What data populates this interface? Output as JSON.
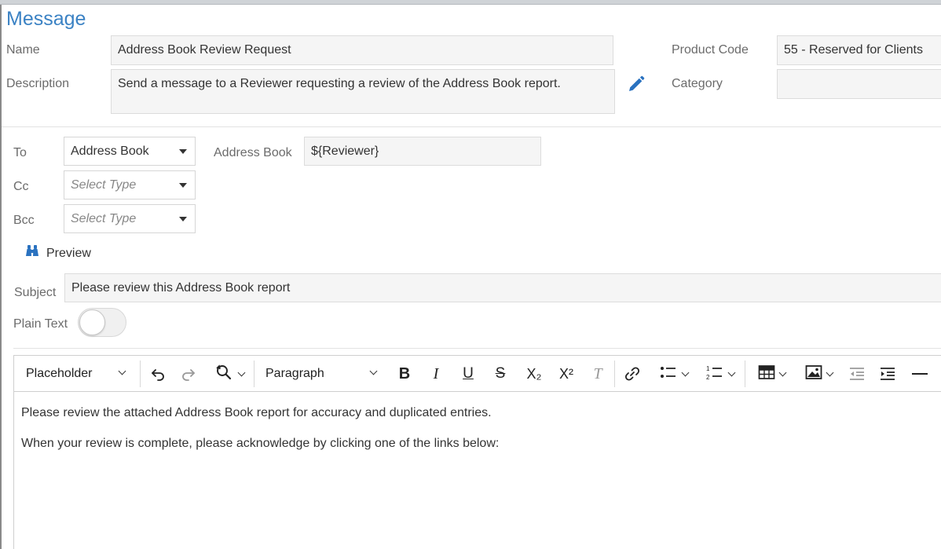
{
  "header": {
    "title": "Message"
  },
  "details": {
    "name_label": "Name",
    "name_value": "Address Book Review Request",
    "description_label": "Description",
    "description_value": "Send a message to a Reviewer requesting a review of the Address Book report.",
    "product_code_label": "Product Code",
    "product_code_value": "55 - Reserved for Clients",
    "category_label": "Category",
    "category_value": ""
  },
  "recipients": {
    "to_label": "To",
    "to_value": "Address Book",
    "address_book_label": "Address Book",
    "address_book_value": "${Reviewer}",
    "cc_label": "Cc",
    "cc_placeholder": "Select Type",
    "bcc_label": "Bcc",
    "bcc_placeholder": "Select Type"
  },
  "preview": {
    "label": "Preview"
  },
  "subject": {
    "label": "Subject",
    "value": "Please review this Address Book report"
  },
  "plain_text": {
    "label": "Plain Text",
    "enabled": false
  },
  "toolbar": {
    "placeholder_label": "Placeholder",
    "paragraph_label": "Paragraph",
    "subscript_glyph": "X₂",
    "superscript_glyph": "X²",
    "clear_format_glyph": "T"
  },
  "editor": {
    "paragraphs": [
      "Please review the attached Address Book report for accuracy and duplicated entries.",
      "When your review is complete, please acknowledge by clicking one of the links below:"
    ]
  },
  "colors": {
    "accent": "#3b82c4",
    "pencil": "#2a72c0"
  },
  "icons": [
    "pencil-icon",
    "binoculars-icon",
    "undo-icon",
    "redo-icon",
    "find-replace-icon",
    "bold-icon",
    "italic-icon",
    "underline-icon",
    "strikethrough-icon",
    "subscript-icon",
    "superscript-icon",
    "clear-format-icon",
    "link-icon",
    "bulleted-list-icon",
    "numbered-list-icon",
    "table-icon",
    "image-icon",
    "outdent-icon",
    "indent-icon",
    "horizontal-line-icon"
  ]
}
